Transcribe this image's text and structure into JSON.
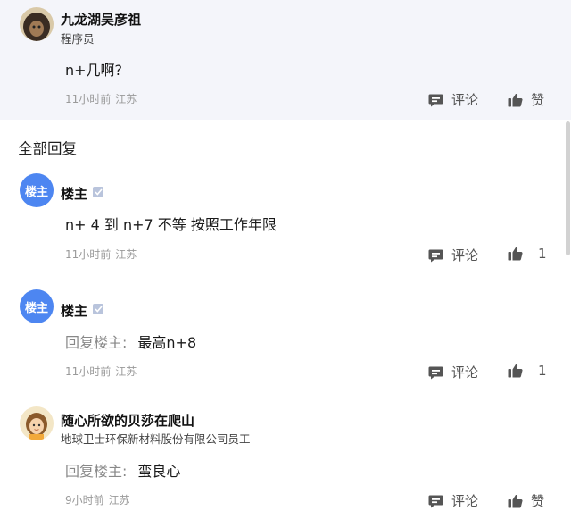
{
  "op": {
    "name": "九龙湖吴彦祖",
    "subtitle": "程序员",
    "content": "n+几啊?",
    "time": "11小时前",
    "location": "江苏",
    "comment_label": "评论",
    "like_label": "赞"
  },
  "section_title": "全部回复",
  "replies": [
    {
      "avatar_text": "楼主",
      "name": "楼主",
      "reply_prefix": "",
      "content": "n+ 4 到 n+7 不等 按照工作年限",
      "time": "11小时前",
      "location": "江苏",
      "comment_label": "评论",
      "like_label": "1"
    },
    {
      "avatar_text": "楼主",
      "name": "楼主",
      "reply_prefix": "回复楼主:",
      "content": "最高n+8",
      "time": "11小时前",
      "location": "江苏",
      "comment_label": "评论",
      "like_label": "1"
    },
    {
      "name": "随心所欲的贝莎在爬山",
      "subtitle": "地球卫士环保新材料股份有限公司员工",
      "reply_prefix": "回复楼主:",
      "content": "蛮良心",
      "time": "9小时前",
      "location": "江苏",
      "comment_label": "评论",
      "like_label": "赞"
    }
  ],
  "colors": {
    "op_background": "#f4f5fa",
    "lz_avatar": "#4d86f1"
  }
}
